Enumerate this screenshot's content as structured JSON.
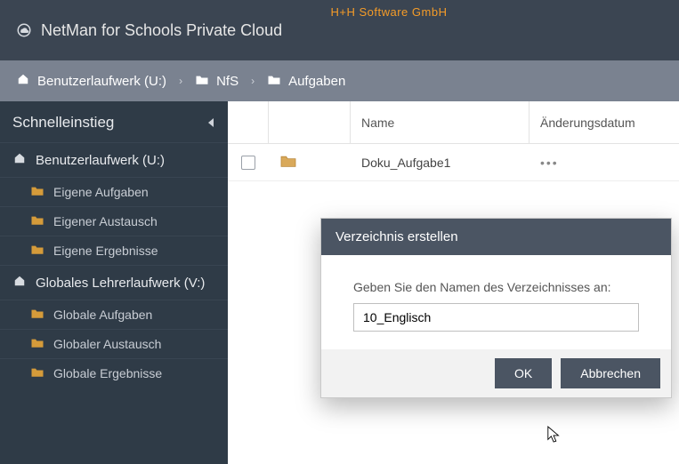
{
  "brand": "H+H Software GmbH",
  "app_title": "NetMan for Schools Private Cloud",
  "breadcrumb": {
    "root": "Benutzerlaufwerk (U:)",
    "mid": "NfS",
    "leaf": "Aufgaben"
  },
  "sidebar": {
    "header": "Schnelleinstieg",
    "sections": [
      {
        "label": "Benutzerlaufwerk (U:)",
        "items": [
          {
            "label": "Eigene Aufgaben"
          },
          {
            "label": "Eigener Austausch"
          },
          {
            "label": "Eigene Ergebnisse"
          }
        ]
      },
      {
        "label": "Globales Lehrerlaufwerk (V:)",
        "items": [
          {
            "label": "Globale Aufgaben"
          },
          {
            "label": "Globaler Austausch"
          },
          {
            "label": "Globale Ergebnisse"
          }
        ]
      }
    ]
  },
  "table": {
    "columns": {
      "name": "Name",
      "date": "Änderungsdatum"
    },
    "rows": [
      {
        "name": "Doku_Aufgabe1",
        "actions": "•••"
      }
    ]
  },
  "dialog": {
    "title": "Verzeichnis erstellen",
    "prompt": "Geben Sie den Namen des Verzeichnisses an:",
    "value": "10_Englisch",
    "ok": "OK",
    "cancel": "Abbrechen"
  }
}
